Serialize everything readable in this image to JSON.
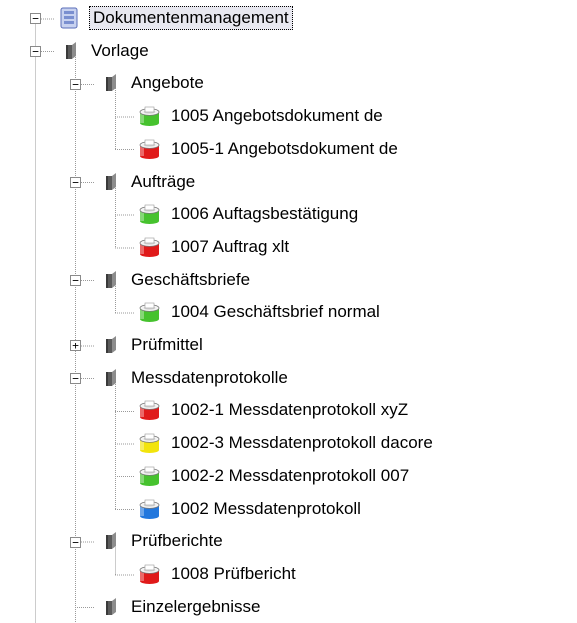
{
  "tree": {
    "colors": {
      "db_green": "#46c22e",
      "db_red": "#e01a1a",
      "db_yellow": "#f2e40c",
      "db_blue": "#2277dd",
      "folder_gray": "#7a7a7a",
      "root_blue": "#7a8fd0"
    },
    "nodes": [
      {
        "label": "Dokumentenmanagement",
        "icon": "document-management-icon",
        "depth": 0,
        "toggle": "minus",
        "last": true,
        "focused": true
      },
      {
        "label": "Vorlage",
        "icon": "folder-icon",
        "depth": 1,
        "toggle": "minus",
        "last": true
      },
      {
        "label": "Angebote",
        "icon": "folder-icon",
        "depth": 2,
        "toggle": "minus",
        "last": false
      },
      {
        "label": "1005 Angebotsdokument de",
        "icon": "db-green-icon",
        "depth": 3,
        "toggle": "none",
        "last": false
      },
      {
        "label": "1005-1 Angebotsdokument de",
        "icon": "db-red-icon",
        "depth": 3,
        "toggle": "none",
        "last": true
      },
      {
        "label": "Aufträge",
        "icon": "folder-icon",
        "depth": 2,
        "toggle": "minus",
        "last": false
      },
      {
        "label": "1006 Auftagsbestätigung",
        "icon": "db-green-icon",
        "depth": 3,
        "toggle": "none",
        "last": false
      },
      {
        "label": "1007 Auftrag xlt",
        "icon": "db-red-icon",
        "depth": 3,
        "toggle": "none",
        "last": true
      },
      {
        "label": "Geschäftsbriefe",
        "icon": "folder-icon",
        "depth": 2,
        "toggle": "minus",
        "last": false
      },
      {
        "label": "1004 Geschäftsbrief normal",
        "icon": "db-green-icon",
        "depth": 3,
        "toggle": "none",
        "last": true
      },
      {
        "label": "Prüfmittel",
        "icon": "folder-icon",
        "depth": 2,
        "toggle": "plus",
        "last": false
      },
      {
        "label": "Messdatenprotokolle",
        "icon": "folder-icon",
        "depth": 2,
        "toggle": "minus",
        "last": false
      },
      {
        "label": "1002-1 Messdatenprotokoll xyZ",
        "icon": "db-red-icon",
        "depth": 3,
        "toggle": "none",
        "last": false
      },
      {
        "label": "1002-3 Messdatenprotokoll dacore",
        "icon": "db-yellow-icon",
        "depth": 3,
        "toggle": "none",
        "last": false
      },
      {
        "label": "1002-2 Messdatenprotokoll 007",
        "icon": "db-green-icon",
        "depth": 3,
        "toggle": "none",
        "last": false
      },
      {
        "label": "1002 Messdatenprotokoll",
        "icon": "db-blue-icon",
        "depth": 3,
        "toggle": "none",
        "last": true
      },
      {
        "label": "Prüfberichte",
        "icon": "folder-icon",
        "depth": 2,
        "toggle": "minus",
        "last": false
      },
      {
        "label": "1008 Prüfbericht",
        "icon": "db-red-icon",
        "depth": 3,
        "toggle": "none",
        "last": true
      },
      {
        "label": "Einzelergebnisse",
        "icon": "folder-icon",
        "depth": 2,
        "toggle": "none",
        "last": false
      }
    ]
  }
}
